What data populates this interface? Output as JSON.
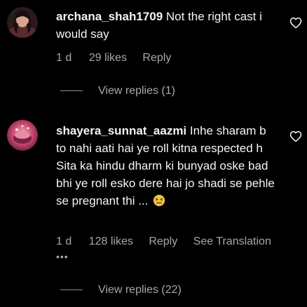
{
  "comments": [
    {
      "username": "archana_shah1709",
      "text": "Not the right cast i would say",
      "time": "1 d",
      "likes": "29 likes",
      "reply_label": "Reply",
      "view_replies": "View replies (1)"
    },
    {
      "username": "shayera_sunnat_aazmi",
      "text": "Inhe sharam b to nahi aati hai ye roll kitna respected h Sita ka hindu dharm ki bunyad oske bad bhi ye roll esko dere hai jo shadi se pehle se pregnant thi ...",
      "time": "1 d",
      "likes": "128 likes",
      "reply_label": "Reply",
      "translation_label": "See Translation",
      "more_label": "•••",
      "view_replies": "View replies (22)"
    }
  ],
  "colors": {
    "background": "#000000",
    "primary_text": "#f5f5f5",
    "secondary_text": "#a8a8a8"
  },
  "icons": {
    "like": "heart-outline-icon",
    "emoji": "persevering-face-emoji"
  }
}
